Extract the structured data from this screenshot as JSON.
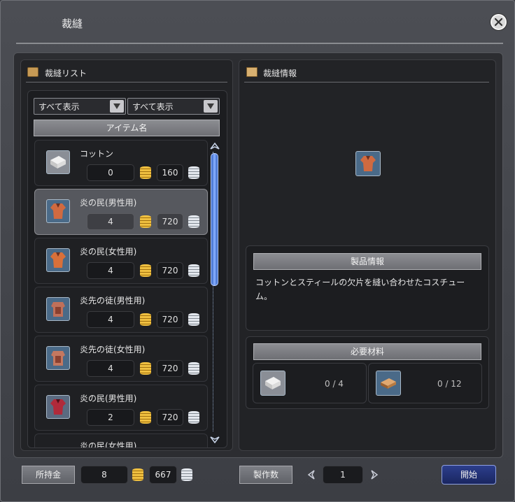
{
  "window": {
    "title": "裁縫"
  },
  "list_panel": {
    "title": "裁縫リスト",
    "filter1": "すべて表示",
    "filter2": "すべて表示",
    "column_header": "アイテム名",
    "items": [
      {
        "name": "コットン",
        "gold": "0",
        "silver": "160",
        "icon": "cotton-icon"
      },
      {
        "name": "炎の民(男性用)",
        "gold": "4",
        "silver": "720",
        "icon": "costume-icon"
      },
      {
        "name": "炎の民(女性用)",
        "gold": "4",
        "silver": "720",
        "icon": "costume-icon"
      },
      {
        "name": "炎先の徒(男性用)",
        "gold": "4",
        "silver": "720",
        "icon": "armor-icon"
      },
      {
        "name": "炎先の徒(女性用)",
        "gold": "4",
        "silver": "720",
        "icon": "armor-icon"
      },
      {
        "name": "炎の民(男性用)",
        "gold": "2",
        "silver": "720",
        "icon": "costume-red-icon"
      },
      {
        "name": "炎の民(女性用)"
      }
    ],
    "selected_index": 1
  },
  "info_panel": {
    "title": "裁縫情報",
    "product_header": "製品情報",
    "description": "コットンとスティールの欠片を縫い合わせたコスチューム。",
    "materials_header": "必要材料",
    "materials": [
      {
        "icon": "cotton-icon",
        "count": "0 / 4"
      },
      {
        "icon": "leather-icon",
        "count": "0 / 12"
      }
    ]
  },
  "footer": {
    "money_label": "所持金",
    "gold": "8",
    "silver": "667",
    "craft_count_label": "製作数",
    "craft_count": "1",
    "start_label": "開始"
  },
  "colors": {
    "start_button": "#1f2d70",
    "scroll_thumb": "#5b8cf0"
  }
}
